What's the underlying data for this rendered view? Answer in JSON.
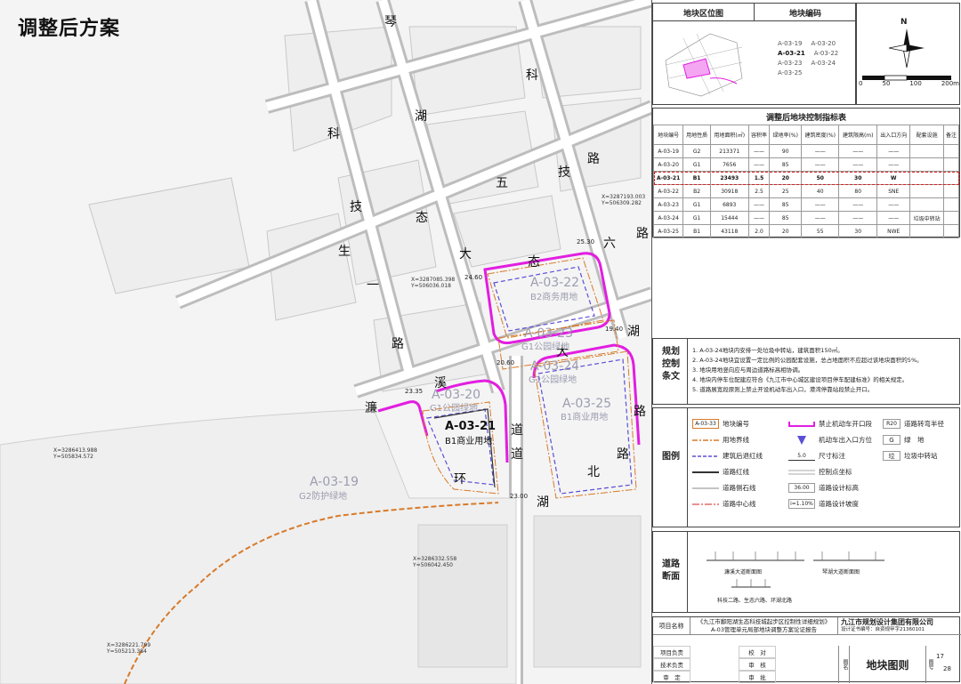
{
  "page_title": "调整后方案",
  "map": {
    "road_chars": [
      "琴",
      "科",
      "湖",
      "路",
      "科",
      "技",
      "生",
      "一",
      "路",
      "五",
      "技",
      "态",
      "大",
      "态",
      "六",
      "路",
      "湖",
      "大",
      "道",
      "溪",
      "濂",
      "道",
      "环",
      "北",
      "路",
      "湖",
      "路"
    ],
    "parcels_gray": [
      {
        "code": "A-03-22",
        "use": "B2商务用地"
      },
      {
        "code": "A-03-23",
        "use": "G1公园绿地"
      },
      {
        "code": "A-03-24",
        "use": "G1公园绿地"
      },
      {
        "code": "A-03-20",
        "use": "G1公园绿地"
      },
      {
        "code": "A-03-25",
        "use": "B1商业用地"
      },
      {
        "code": "A-03-19",
        "use": "G2防护绿地"
      }
    ],
    "parcel_main": {
      "code": "A-03-21",
      "use": "B1商业用地"
    },
    "elevations": [
      "25.30",
      "24.60",
      "19.40",
      "20.60",
      "23.35",
      "23.00"
    ],
    "coords": [
      {
        "x": "X=3287193.003",
        "y": "Y=506309.282"
      },
      {
        "x": "X=3287085.398",
        "y": "Y=506036.018"
      },
      {
        "x": "X=3286413.988",
        "y": "Y=505834.572"
      },
      {
        "x": "X=3286332.558",
        "y": "Y=506042.450"
      },
      {
        "x": "X=3286221.799",
        "y": "Y=505213.384"
      }
    ]
  },
  "panel": {
    "location_map_title": "地块区位图",
    "parcel_code_title": "地块编码",
    "parcel_codes": [
      "A-03-19",
      "A-03-20",
      "A-03-21",
      "A-03-22",
      "A-03-23",
      "A-03-24",
      "A-03-25"
    ],
    "north_label": "N",
    "scale_labels": [
      "0",
      "50",
      "100",
      "200m"
    ],
    "table_title": "调整后地块控制指标表",
    "table_headers": [
      "地块编号",
      "用地性质",
      "用地面积(㎡)",
      "容积率",
      "绿地率(%)",
      "建筑密度(%)",
      "建筑限高(m)",
      "出入口方向",
      "配套设施",
      "备注"
    ],
    "table_rows": [
      [
        "A-03-19",
        "G2",
        "213371",
        "——",
        "90",
        "——",
        "——",
        "——",
        "",
        ""
      ],
      [
        "A-03-20",
        "G1",
        "7656",
        "——",
        "85",
        "——",
        "——",
        "——",
        "",
        ""
      ],
      [
        "A-03-21",
        "B1",
        "23493",
        "1.5",
        "20",
        "50",
        "30",
        "W",
        "",
        ""
      ],
      [
        "A-03-22",
        "B2",
        "30918",
        "2.5",
        "25",
        "40",
        "80",
        "SNE",
        "",
        ""
      ],
      [
        "A-03-23",
        "G1",
        "6893",
        "——",
        "85",
        "——",
        "——",
        "——",
        "",
        ""
      ],
      [
        "A-03-24",
        "G1",
        "15444",
        "——",
        "85",
        "——",
        "——",
        "——",
        "垃圾中转站",
        ""
      ],
      [
        "A-03-25",
        "B1",
        "43118",
        "2.0",
        "20",
        "55",
        "30",
        "NWE",
        "",
        ""
      ]
    ],
    "rules_title": "规划控制条文",
    "rules": [
      "1. A-03-24地块内安排一处垃圾中转站，建筑面积150㎡。",
      "2. A-03-24地块宜设置一定比例的公园配套设施，总占地面积不应超过该地块面积的5%。",
      "3. 地块用地竖向应与周边道路标高相协调。",
      "4. 地块内停车位配建应符合《九江市中心城区建设项目停车配建标准》的相关规定。",
      "5. 道路展宽段原则上禁止开设机动车出入口，港湾停靠站段禁止开口。"
    ],
    "legend_title": "图例",
    "legend": [
      {
        "sym": "A-03-33",
        "label": "地块编号"
      },
      {
        "sym": "",
        "label": "用地界线"
      },
      {
        "sym": "",
        "label": "建筑后退红线"
      },
      {
        "sym": "",
        "label": "道路红线"
      },
      {
        "sym": "",
        "label": "道路侧石线"
      },
      {
        "sym": "",
        "label": "道路中心线"
      },
      {
        "sym": "",
        "label": "禁止机动车开口段"
      },
      {
        "sym": "",
        "label": "机动车出入口方位"
      },
      {
        "sym": "5.0",
        "label": "尺寸标注"
      },
      {
        "sym": "",
        "label": "控制点坐标"
      },
      {
        "sym": "36.00",
        "label": "道路设计标高"
      },
      {
        "sym": "i=1.10%",
        "label": "道路设计坡度"
      },
      {
        "sym": "R20",
        "label": "道路转弯半径"
      },
      {
        "sym": "G",
        "label": "绿　地"
      },
      {
        "sym": "垃",
        "label": "垃圾中转站"
      }
    ],
    "road_section_title": "道路断面",
    "road_sections": [
      "濂溪大道断面图",
      "琴湖大道断面图",
      "科技二路、生态六路、环湖北路"
    ],
    "project_name_label": "项目名称",
    "project_name": "《九江市鄱阳湖生态科技城起步区控制性详细规划》",
    "project_name_2": "A-03管理单元局部地块调整方案论证报告",
    "company": "九江市规划设计集团有限公司",
    "cert": "设计证书编号：自资规甲字21360101",
    "signoff_labels": [
      "项目负责",
      "技术负责",
      "审　定",
      "校　对",
      "审　核",
      "审　批"
    ],
    "drawing_label": "图名",
    "drawing_name": "地块图则",
    "drawing_no_label": "图号",
    "drawing_no": "17",
    "drawing_total": "28"
  }
}
